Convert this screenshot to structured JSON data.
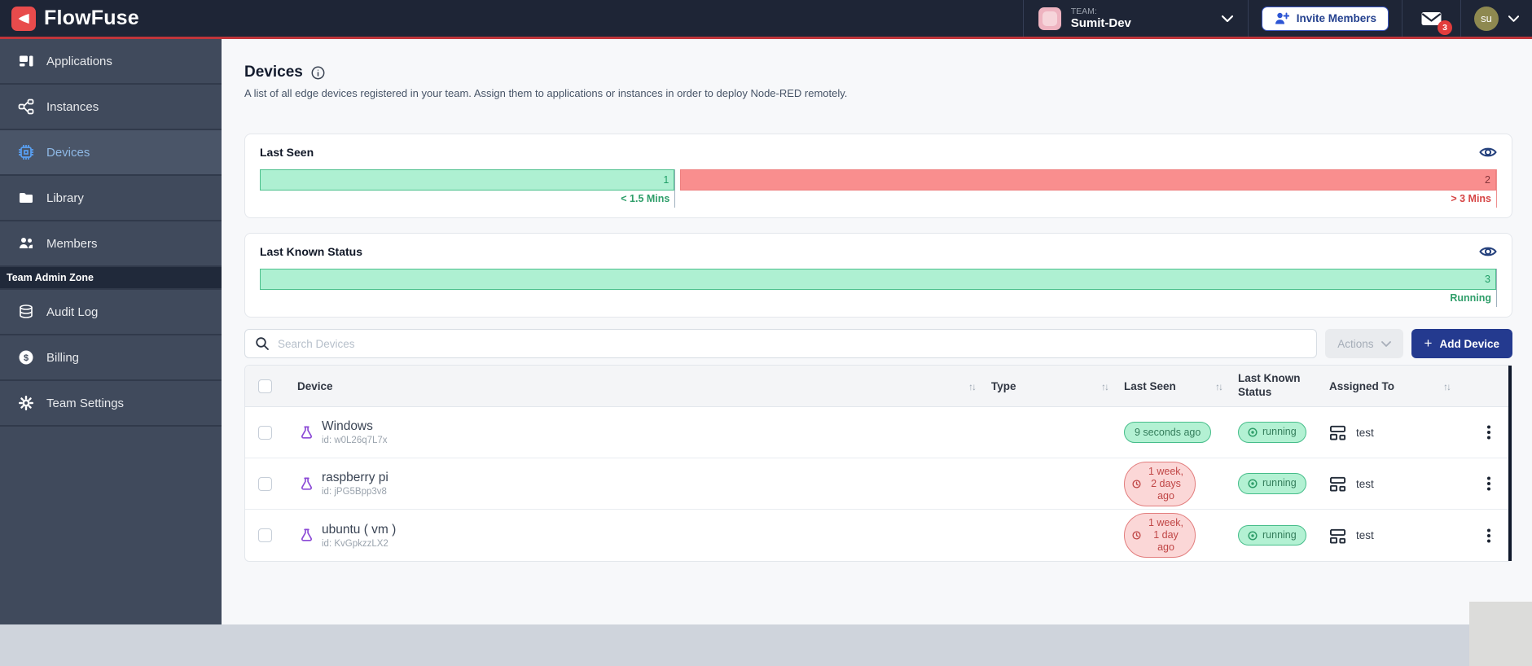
{
  "navbar": {
    "brand": "FlowFuse",
    "team_label": "TEAM:",
    "team_name": "Sumit-Dev",
    "invite_button_label": "Invite Members",
    "notification_count": "3",
    "avatar_initials": "su"
  },
  "sidebar": {
    "items": [
      {
        "label": "Applications",
        "icon": "applications-icon"
      },
      {
        "label": "Instances",
        "icon": "instances-icon"
      },
      {
        "label": "Devices",
        "icon": "devices-icon",
        "active": true
      },
      {
        "label": "Library",
        "icon": "library-icon"
      },
      {
        "label": "Members",
        "icon": "members-icon"
      }
    ],
    "admin_zone_label": "Team Admin Zone",
    "admin_items": [
      {
        "label": "Audit Log",
        "icon": "audit-log-icon"
      },
      {
        "label": "Billing",
        "icon": "billing-icon"
      },
      {
        "label": "Team Settings",
        "icon": "team-settings-icon"
      }
    ]
  },
  "page": {
    "title": "Devices",
    "subtitle": "A list of all edge devices registered in your team. Assign them to applications or instances in order to deploy Node-RED remotely."
  },
  "cards": {
    "last_seen": {
      "title": "Last Seen",
      "segments": [
        {
          "value": "1",
          "label": "< 1.5 Mins",
          "color": "green"
        },
        {
          "value": "2",
          "label": "> 3 Mins",
          "color": "red"
        }
      ]
    },
    "last_known_status": {
      "title": "Last Known Status",
      "segments": [
        {
          "value": "3",
          "label": "Running",
          "color": "green"
        }
      ]
    }
  },
  "toolbar": {
    "search_placeholder": "Search Devices",
    "actions_label": "Actions",
    "add_device_label": "Add Device",
    "plus_glyph": "+"
  },
  "table": {
    "columns": [
      "Device",
      "Type",
      "Last Seen",
      "Last Known Status",
      "Assigned To"
    ],
    "rows": [
      {
        "name": "Windows",
        "id": "id: w0L26q7L7x",
        "last_seen": "9 seconds ago",
        "last_seen_state": "recent",
        "status": "running",
        "assigned_to": "test"
      },
      {
        "name": "raspberry pi",
        "id": "id: jPG5Bpp3v8",
        "last_seen": "1 week, 2 days ago",
        "last_seen_state": "stale",
        "status": "running",
        "assigned_to": "test"
      },
      {
        "name": "ubuntu ( vm )",
        "id": "id: KvGpkzzLX2",
        "last_seen": "1 week, 1 day ago",
        "last_seen_state": "stale",
        "status": "running",
        "assigned_to": "test"
      }
    ]
  },
  "icons": {
    "sort_glyph": "↑↓"
  },
  "colors": {
    "brand_red": "#e84b4c",
    "navbar_bg": "#1e2536",
    "sidebar_bg": "#404a5c",
    "primary_button": "#243a8f",
    "green_fill": "#aef0d2",
    "green_border": "#4cc08c",
    "green_text": "#2f9e6a",
    "red_fill": "#f98e8e",
    "red_text": "#d64545",
    "badge_red_bg": "#fbd7d7"
  }
}
